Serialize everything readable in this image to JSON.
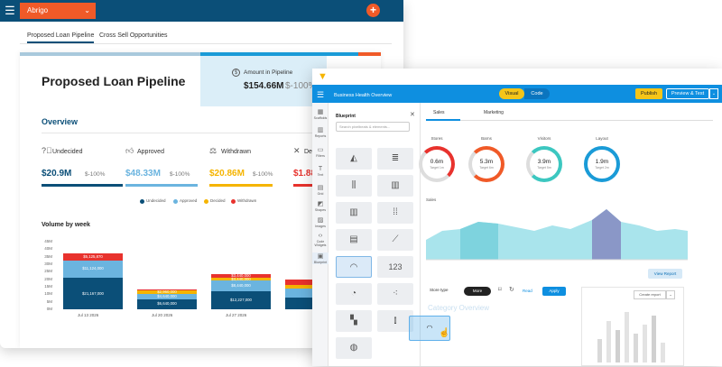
{
  "back": {
    "app_name": "Abrigo",
    "tabs": [
      "Proposed Loan Pipeline",
      "Cross Sell Opportunities"
    ],
    "title": "Proposed Loan Pipeline",
    "amount_label": "Amount in Pipeline",
    "amount_value": "$154.66M",
    "amount_sub": "$-100%",
    "overview": "Overview",
    "kpis": [
      {
        "label": "Undecided",
        "value": "$20.9M",
        "sub": "$-100%",
        "color": "#0b4f78"
      },
      {
        "label": "Approved",
        "value": "$48.33M",
        "sub": "$-100%",
        "color": "#6bb4df"
      },
      {
        "label": "Withdrawn",
        "value": "$20.86M",
        "sub": "$-100%",
        "color": "#f5b400"
      },
      {
        "label": "De",
        "value": "$1.88",
        "sub": "",
        "color": "#e8322d"
      }
    ],
    "legend": [
      "Undecided",
      "Approved",
      "Decided",
      "Withdrawn"
    ],
    "volume_title": "Volume by week"
  },
  "chart_data": {
    "type": "bar",
    "title": "Volume by week",
    "categories": [
      "Jul 13 2026",
      "Jul 20 2026",
      "Jul 27 2026",
      ""
    ],
    "yticks": [
      "45M",
      "40M",
      "35M",
      "30M",
      "25M",
      "20M",
      "15M",
      "10M",
      "5M",
      "0M"
    ],
    "ylim": [
      0,
      45
    ],
    "series": [
      {
        "name": "Undecided",
        "color": "#0b4f78",
        "values": [
          21.1,
          6.4,
          12.2,
          8.0
        ],
        "labels": [
          "$21,167,000",
          "$6,640,000",
          "$12,227,000",
          ""
        ]
      },
      {
        "name": "Approved",
        "color": "#6bb4df",
        "values": [
          11.1,
          4.0,
          7.0,
          6.0
        ],
        "labels": [
          "$11,124,000",
          "$4,640,000",
          "$8,440,000",
          ""
        ]
      },
      {
        "name": "Decided",
        "color": "#f5b400",
        "values": [
          0,
          2.0,
          2.0,
          2.5
        ],
        "labels": [
          "",
          "$2,960,000",
          "$3,440,000",
          ""
        ]
      },
      {
        "name": "Withdrawn",
        "color": "#e8322d",
        "values": [
          5.2,
          1.0,
          2.3,
          3.5
        ],
        "labels": [
          "$5,125,870",
          "",
          "$3,440,000",
          ""
        ]
      }
    ]
  },
  "front": {
    "title": "Business Health Overview",
    "visual": "Visual",
    "code": "Code",
    "publish": "Publish",
    "preview": "Preview & Test",
    "side_items": [
      "Scaffolds",
      "Reports",
      "Filters",
      "Text",
      "Grid",
      "Shapes",
      "Images",
      "Code Widgets",
      "Blueprint"
    ],
    "blueprint_title": "Blueprint",
    "blueprint_search": "Search pixelbeats & elements...",
    "tabs": [
      "Sales",
      "Marketing"
    ],
    "gauges": [
      {
        "label": "Stores",
        "value": "0.6m",
        "sub": "Target 1m",
        "color": "#e8322d"
      },
      {
        "label": "Barns",
        "value": "5.3m",
        "sub": "Target 6m",
        "color": "#f05a28"
      },
      {
        "label": "Visitors",
        "value": "3.9m",
        "sub": "Target 5m",
        "color": "#3cc7c0"
      },
      {
        "label": "Layout",
        "value": "1.9m",
        "sub": "Target 2m",
        "color": "#1a9bd7"
      }
    ],
    "area_label": "Sales",
    "view_report": "View Report",
    "store_type": "Store type",
    "more": "More",
    "read": "Read",
    "apply": "Apply",
    "category": "Category Overview",
    "create_report": "Create report",
    "number_tile": "123"
  }
}
